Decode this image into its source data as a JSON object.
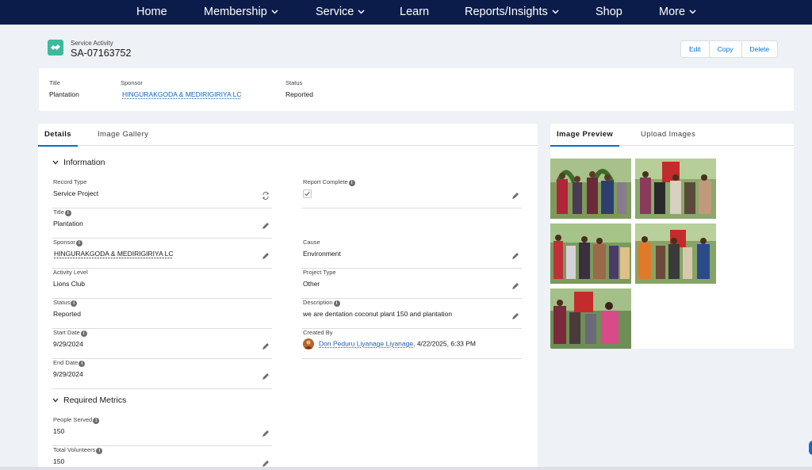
{
  "nav": {
    "items": [
      {
        "label": "Home",
        "dropdown": false
      },
      {
        "label": "Membership",
        "dropdown": true
      },
      {
        "label": "Service",
        "dropdown": true
      },
      {
        "label": "Learn",
        "dropdown": false
      },
      {
        "label": "Reports/Insights",
        "dropdown": true
      },
      {
        "label": "Shop",
        "dropdown": false
      },
      {
        "label": "More",
        "dropdown": true
      }
    ]
  },
  "record": {
    "object_label": "Service Activity",
    "record_id": "SA-07163752",
    "icon": "service-activity-icon",
    "actions": [
      "Edit",
      "Copy",
      "Delete"
    ]
  },
  "highlights": {
    "title_label": "Title",
    "title_value": "Plantation",
    "sponsor_label": "Sponsor",
    "sponsor_value": "HINGURAKGODA & MEDIRIGIRIYA LC",
    "status_label": "Status",
    "status_value": "Reported"
  },
  "details": {
    "tabs": [
      "Details",
      "Image Gallery"
    ],
    "active_tab": "Details",
    "information_header": "Information",
    "metrics_header": "Required Metrics",
    "record_type_label": "Record Type",
    "record_type_value": "Service Project",
    "report_complete_label": "Report Complete",
    "report_complete_checked": true,
    "title_label": "Title",
    "title_value": "Plantation",
    "sponsor_label": "Sponsor",
    "sponsor_value": "HINGURAKGODA & MEDIRIGIRIYA LC",
    "cause_label": "Cause",
    "cause_value": "Environment",
    "activity_level_label": "Activity Level",
    "activity_level_value": "Lions Club",
    "project_type_label": "Project Type",
    "project_type_value": "Other",
    "status_label": "Status",
    "status_value": "Reported",
    "description_label": "Description",
    "description_value": "we are dentation coconut plant 150 and plantation",
    "start_date_label": "Start Date",
    "start_date_value": "9/29/2024",
    "created_by_label": "Created By",
    "created_by_name": "Don Peduru Liyanage Liyanage",
    "created_by_date": ", 4/22/2025, 6:33 PM",
    "end_date_label": "End Date",
    "end_date_value": "9/29/2024",
    "people_served_label": "People Served",
    "people_served_value": "150",
    "total_volunteers_label": "Total Volunteers",
    "total_volunteers_value": "150"
  },
  "preview": {
    "tabs": [
      "Image Preview",
      "Upload Images"
    ],
    "active_tab": "Image Preview",
    "image_count": 5
  },
  "colors": {
    "nav_bg": "#0c1c4a",
    "accent": "#0070d2",
    "record_icon": "#3bba9c",
    "link": "#1b5eb4"
  }
}
